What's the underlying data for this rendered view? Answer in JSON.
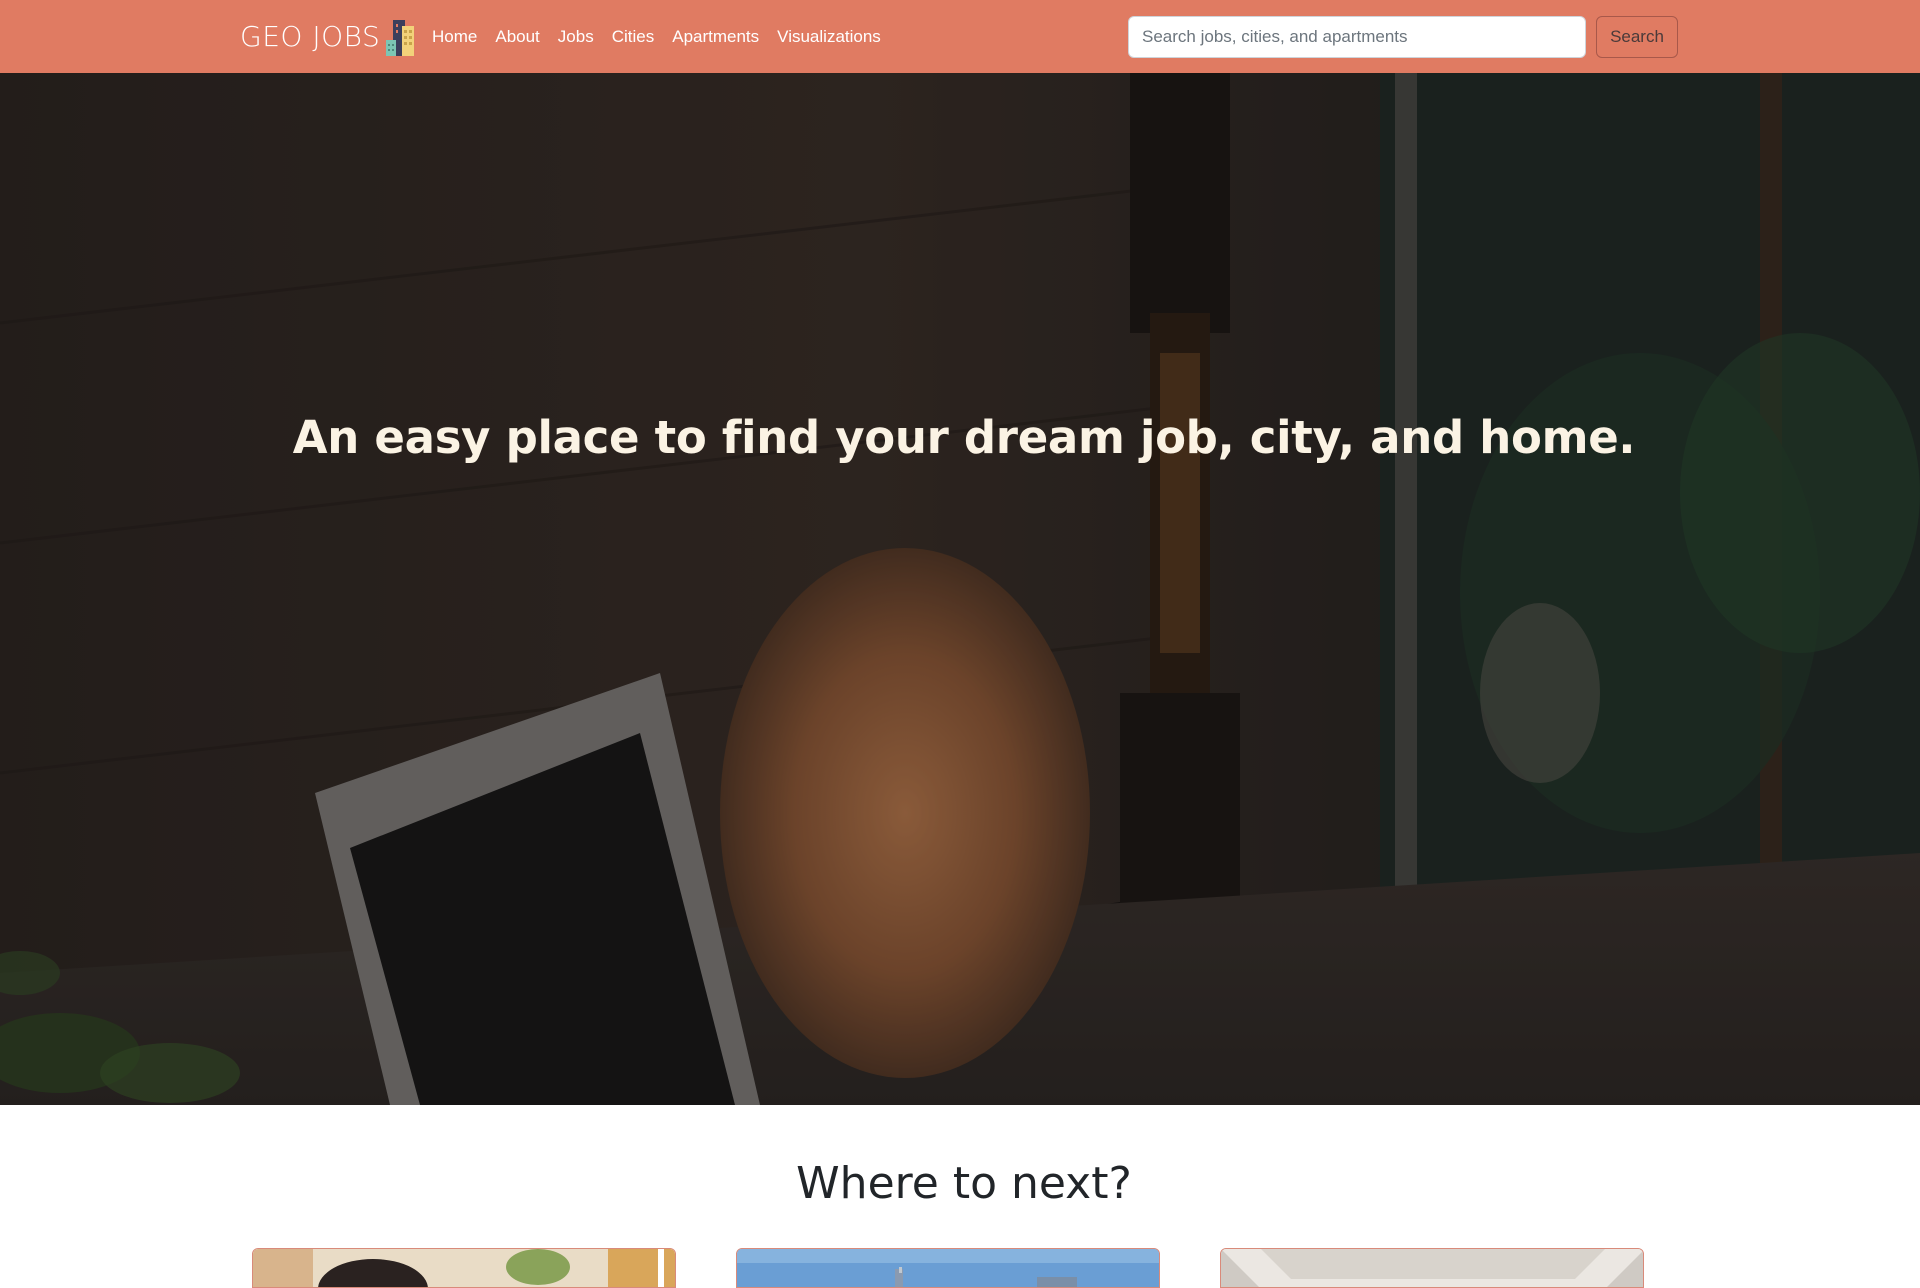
{
  "brand": {
    "name": "GEO JOBS",
    "logo_icon": "city-buildings-icon"
  },
  "nav": {
    "items": [
      {
        "label": "Home"
      },
      {
        "label": "About"
      },
      {
        "label": "Jobs"
      },
      {
        "label": "Cities"
      },
      {
        "label": "Apartments"
      },
      {
        "label": "Visualizations"
      }
    ]
  },
  "search": {
    "placeholder": "Search jobs, cities, and apartments",
    "value": "",
    "button_label": "Search"
  },
  "hero": {
    "title": "An easy place to find your dream job, city, and home."
  },
  "section": {
    "title": "Where to next?"
  },
  "colors": {
    "navbar": "#e07b62",
    "hero_text": "#fbf3e4",
    "heading": "#212529",
    "card_border": "#d98a7a"
  }
}
